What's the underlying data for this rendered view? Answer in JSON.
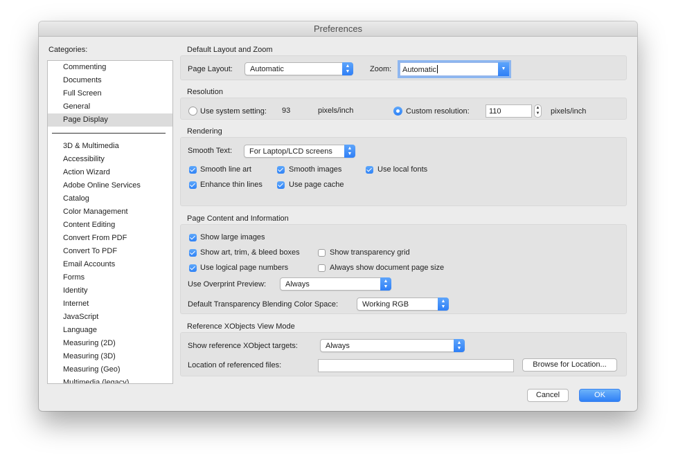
{
  "window": {
    "title": "Preferences"
  },
  "categories": {
    "label": "Categories:",
    "top_items": [
      "Commenting",
      "Documents",
      "Full Screen",
      "General",
      "Page Display"
    ],
    "selected": "Page Display",
    "items": [
      "3D & Multimedia",
      "Accessibility",
      "Action Wizard",
      "Adobe Online Services",
      "Catalog",
      "Color Management",
      "Content Editing",
      "Convert From PDF",
      "Convert To PDF",
      "Email Accounts",
      "Forms",
      "Identity",
      "Internet",
      "JavaScript",
      "Language",
      "Measuring (2D)",
      "Measuring (3D)",
      "Measuring (Geo)",
      "Multimedia (legacy)"
    ]
  },
  "layout_zoom": {
    "title": "Default Layout and Zoom",
    "page_layout_label": "Page Layout:",
    "page_layout_value": "Automatic",
    "zoom_label": "Zoom:",
    "zoom_value": "Automatic"
  },
  "resolution": {
    "title": "Resolution",
    "system_label": "Use system setting:",
    "system_value": "93",
    "system_unit": "pixels/inch",
    "custom_label": "Custom resolution:",
    "custom_value": "110",
    "custom_unit": "pixels/inch"
  },
  "rendering": {
    "title": "Rendering",
    "smooth_text_label": "Smooth Text:",
    "smooth_text_value": "For Laptop/LCD screens",
    "smooth_line_art": "Smooth line art",
    "smooth_images": "Smooth images",
    "use_local_fonts": "Use local fonts",
    "enhance_thin_lines": "Enhance thin lines",
    "use_page_cache": "Use page cache"
  },
  "page_content": {
    "title": "Page Content and Information",
    "show_large_images": "Show large images",
    "show_art_boxes": "Show art, trim, & bleed boxes",
    "show_transparency_grid": "Show transparency grid",
    "use_logical_page_numbers": "Use logical page numbers",
    "always_show_page_size": "Always show document page size",
    "overprint_label": "Use Overprint Preview:",
    "overprint_value": "Always",
    "blending_label": "Default Transparency Blending Color Space:",
    "blending_value": "Working RGB"
  },
  "xobjects": {
    "title": "Reference XObjects View Mode",
    "targets_label": "Show reference XObject targets:",
    "targets_value": "Always",
    "location_label": "Location of referenced files:",
    "location_value": "",
    "browse_label": "Browse for Location..."
  },
  "footer": {
    "cancel_label": "Cancel",
    "ok_label": "OK"
  }
}
